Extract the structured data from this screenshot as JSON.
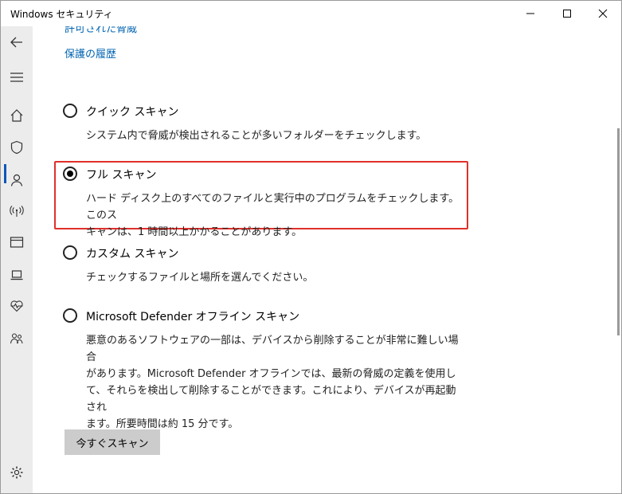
{
  "window": {
    "title": "Windows セキュリティ"
  },
  "sidebar": {
    "items": [
      {
        "name": "back",
        "icon": "back-arrow-icon"
      },
      {
        "name": "menu",
        "icon": "hamburger-menu-icon"
      },
      {
        "name": "home",
        "icon": "home-icon"
      },
      {
        "name": "virus-protection",
        "icon": "shield-icon",
        "active": true
      },
      {
        "name": "account-protection",
        "icon": "person-icon"
      },
      {
        "name": "firewall",
        "icon": "wireless-antenna-icon"
      },
      {
        "name": "app-browser-control",
        "icon": "browser-window-icon"
      },
      {
        "name": "device-security",
        "icon": "laptop-icon"
      },
      {
        "name": "device-health",
        "icon": "heart-pulse-icon"
      },
      {
        "name": "family-options",
        "icon": "family-icon"
      },
      {
        "name": "settings",
        "icon": "gear-icon"
      }
    ]
  },
  "links": {
    "allowed_threats": "許可された脅威",
    "protection_history": "保護の履歴"
  },
  "scan_options": [
    {
      "label": "クイック スキャン",
      "checked": false,
      "description": [
        "システム内で脅威が検出されることが多いフォルダーをチェックします。"
      ]
    },
    {
      "label": "フル スキャン",
      "checked": true,
      "description": [
        "ハード ディスク上のすべてのファイルと実行中のプログラムをチェックします。このス",
        "キャンは、1 時間以上かかることがあります。"
      ]
    },
    {
      "label": "カスタム スキャン",
      "checked": false,
      "description": [
        "チェックするファイルと場所を選んでください。"
      ]
    },
    {
      "label": "Microsoft Defender オフライン スキャン",
      "checked": false,
      "description": [
        "悪意のあるソフトウェアの一部は、デバイスから削除することが非常に難しい場合",
        "があります。Microsoft Defender オフラインでは、最新の脅威の定義を使用し",
        "て、それらを検出して削除することができます。これにより、デバイスが再起動され",
        "ます。所要時間は約 15 分です。"
      ]
    }
  ],
  "scan_button": {
    "label": "今すぐスキャン"
  },
  "colors": {
    "accent": "#0063b1",
    "highlight_border": "#e0302a",
    "sidebar_bg": "#ececec",
    "button_bg": "#cccccc"
  }
}
